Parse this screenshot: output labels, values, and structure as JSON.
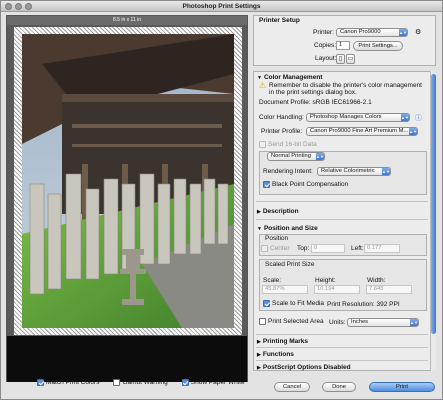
{
  "window": {
    "title": "Photoshop Print Settings"
  },
  "preview": {
    "size_label": "8.5 in x 11 in"
  },
  "bottom": {
    "match_colors": "Match Print Colors",
    "gamut_warning": "Gamut Warning",
    "paper_white": "Show Paper White"
  },
  "printer_setup": {
    "heading": "Printer Setup",
    "printer_label": "Printer:",
    "printer_value": "Canon Pro9000",
    "copies_label": "Copies:",
    "copies_value": "1",
    "print_settings_btn": "Print Settings...",
    "layout_label": "Layout:"
  },
  "color_management": {
    "heading": "Color Management",
    "warning": "Remember to disable the printer's color management in the print settings dialog box.",
    "doc_profile": "Document Profile: sRGB IEC61966-2.1",
    "handling_label": "Color Handling:",
    "handling_value": "Photoshop Manages Colors",
    "printer_profile_label": "Printer Profile:",
    "printer_profile_value": "Canon Pro9000 Fine Art Premium M...",
    "send16": "Send 16-bit Data",
    "normal_printing": "Normal Printing",
    "intent_label": "Rendering Intent:",
    "intent_value": "Relative Colorimetric",
    "bpc": "Black Point Compensation"
  },
  "description": {
    "heading": "Description"
  },
  "position_size": {
    "heading": "Position and Size",
    "position_label": "Position",
    "center": "Center",
    "top_label": "Top:",
    "top_value": "0",
    "left_label": "Left:",
    "left_value": "0.177",
    "scaled_label": "Scaled Print Size",
    "scale_label": "Scale:",
    "scale_value": "45.87%",
    "height_label": "Height:",
    "height_value": "10.194",
    "width_label": "Width:",
    "width_value": "7.645",
    "scale_fit": "Scale to Fit Media",
    "resolution": "Print Resolution: 392 PPI",
    "print_selected": "Print Selected Area",
    "units_label": "Units:",
    "units_value": "Inches"
  },
  "sections": {
    "printing_marks": "Printing Marks",
    "functions": "Functions",
    "postscript": "PostScript Options Disabled"
  },
  "footer": {
    "cancel": "Cancel",
    "done": "Done",
    "print": "Print"
  }
}
